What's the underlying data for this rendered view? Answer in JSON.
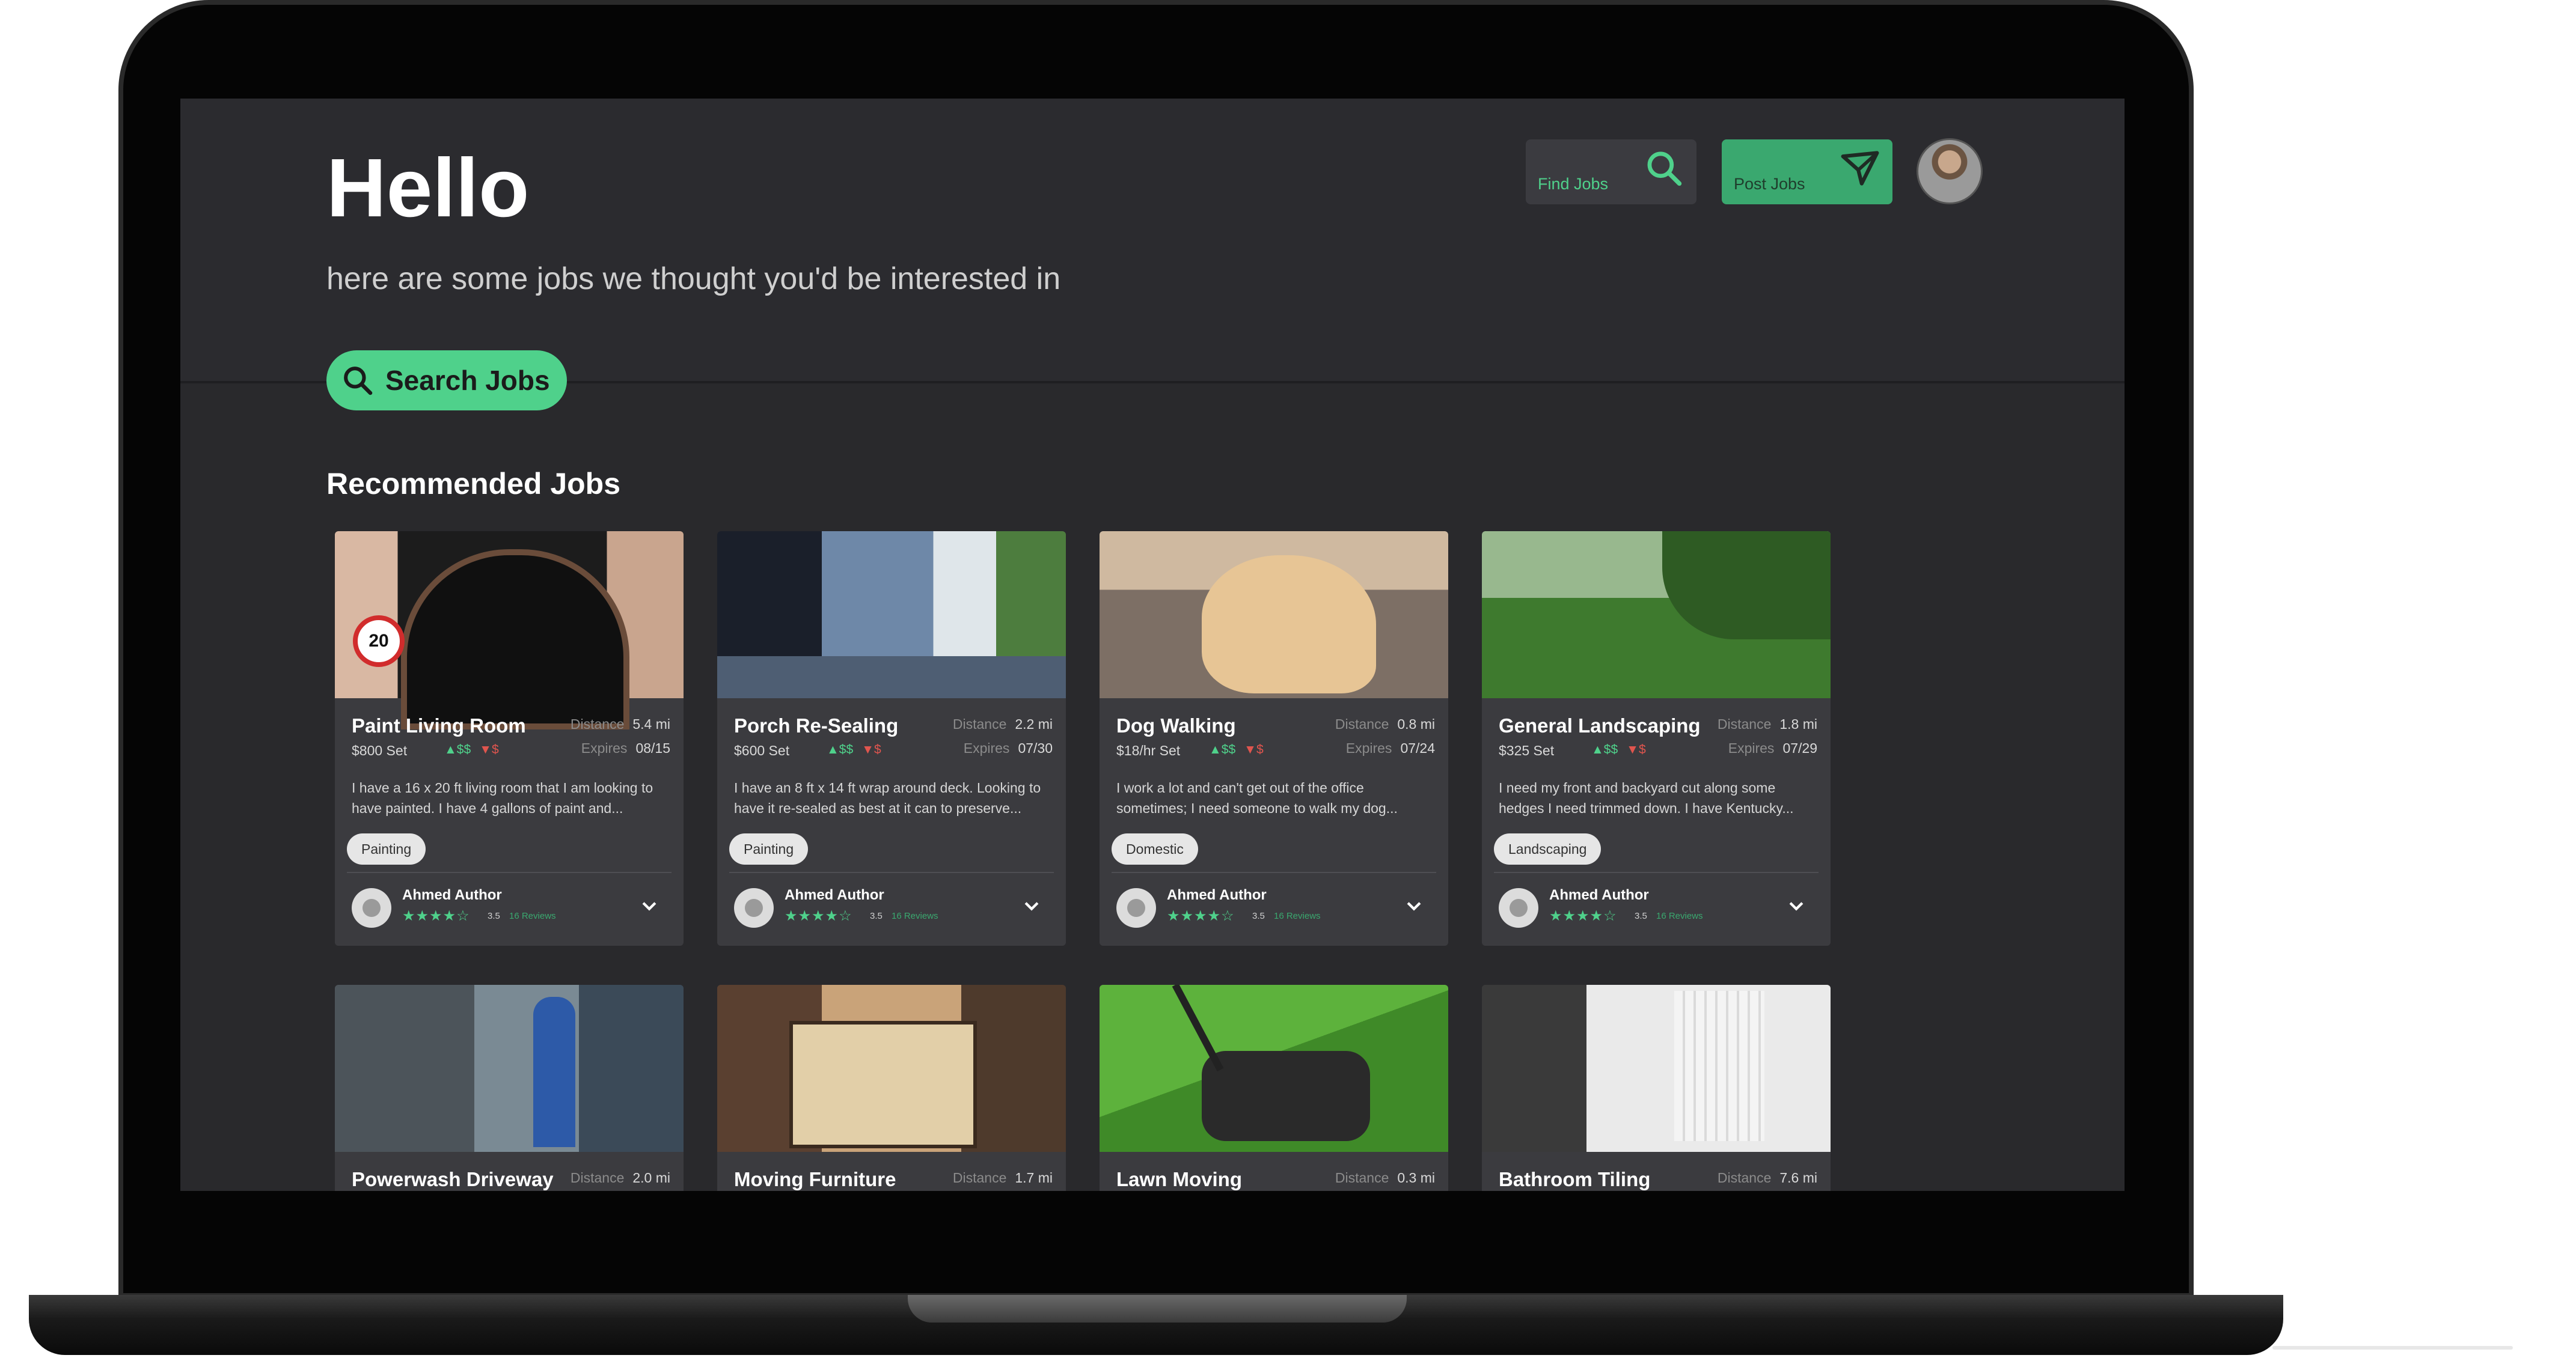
{
  "header": {
    "greeting": "Hello",
    "subtitle": "here are some jobs we thought you'd be interested in",
    "search_button": "Search Jobs",
    "find_jobs": "Find Jobs",
    "post_jobs": "Post Jobs"
  },
  "section_title": "Recommended Jobs",
  "labels": {
    "distance": "Distance",
    "expires": "Expires",
    "up": "▲$$",
    "down": "▼$"
  },
  "colors": {
    "accent": "#4fd18b",
    "background": "#29292c",
    "card": "#3b3b3f",
    "down": "#e0554e"
  },
  "jobs": [
    {
      "title": "Paint Living Room",
      "price": "$800 Set",
      "distance": "5.4 mi",
      "expires": "08/15",
      "description": "I have a 16 x 20 ft living room that I am looking to have painted. I have 4 gallons of paint and...",
      "tag": "Painting",
      "author": "Ahmed Author",
      "stars": "★★★★☆",
      "rating": "3.5",
      "reviews": "16 Reviews"
    },
    {
      "title": "Porch Re-Sealing",
      "price": "$600 Set",
      "distance": "2.2 mi",
      "expires": "07/30",
      "description": "I have an 8 ft x 14 ft wrap around deck. Looking to have it re-sealed as best at it can to preserve...",
      "tag": "Painting",
      "author": "Ahmed Author",
      "stars": "★★★★☆",
      "rating": "3.5",
      "reviews": "16 Reviews"
    },
    {
      "title": "Dog Walking",
      "price": "$18/hr Set",
      "distance": "0.8 mi",
      "expires": "07/24",
      "description": "I work a lot and can't get out of the office sometimes; I need someone to walk my dog...",
      "tag": "Domestic",
      "author": "Ahmed Author",
      "stars": "★★★★☆",
      "rating": "3.5",
      "reviews": "16 Reviews"
    },
    {
      "title": "General Landscaping",
      "price": "$325 Set",
      "distance": "1.8 mi",
      "expires": "07/29",
      "description": "I need my front and backyard cut along some hedges I need trimmed down. I have Kentucky...",
      "tag": "Landscaping",
      "author": "Ahmed Author",
      "stars": "★★★★☆",
      "rating": "3.5",
      "reviews": "16 Reviews"
    },
    {
      "title": "Powerwash Driveway",
      "distance": "2.0 mi"
    },
    {
      "title": "Moving Furniture",
      "distance": "1.7 mi"
    },
    {
      "title": "Lawn Moving",
      "distance": "0.3 mi"
    },
    {
      "title": "Bathroom Tiling",
      "distance": "7.6 mi"
    }
  ]
}
